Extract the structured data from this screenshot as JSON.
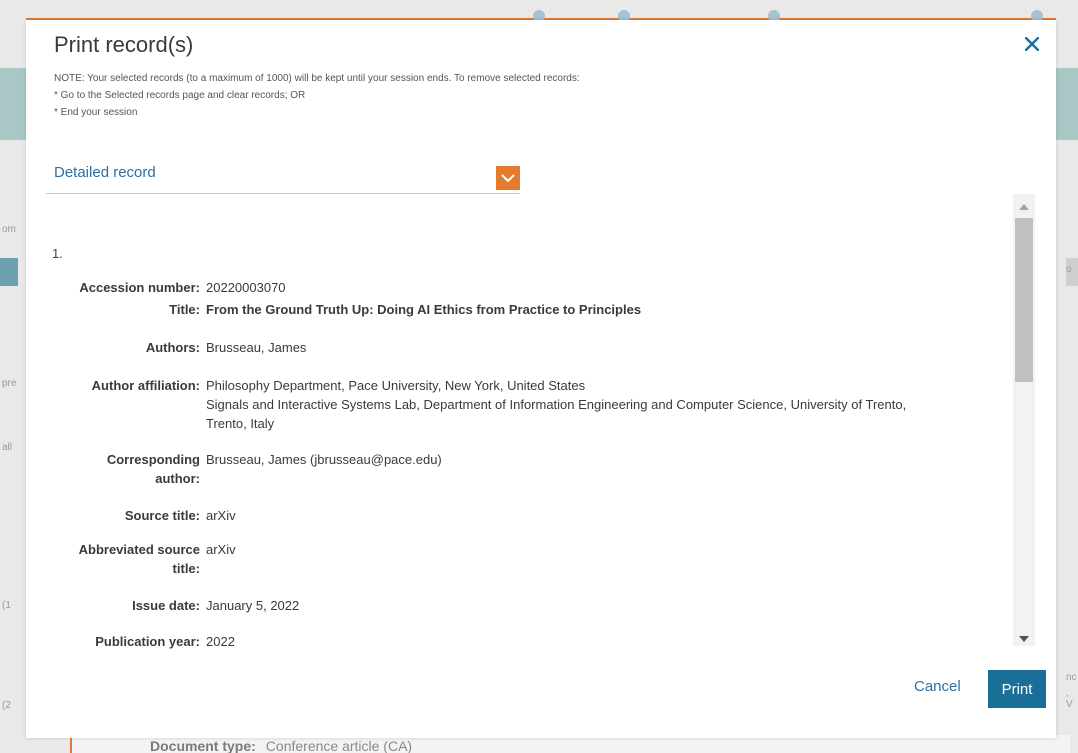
{
  "modal": {
    "title": "Print record(s)",
    "note_lines": [
      "NOTE: Your selected records (to a maximum of 1000) will be kept until your session ends. To remove selected records:",
      "* Go to the Selected records page and clear records; OR",
      "* End your session"
    ],
    "format_select": {
      "selected": "Detailed record"
    },
    "record_number": "1.",
    "fields": [
      {
        "label": "Accession number:",
        "value": "20220003070"
      },
      {
        "label": "Title:",
        "value": "From the Ground Truth Up: Doing AI Ethics from Practice to Principles"
      },
      {
        "label": "Authors:",
        "value": "Brusseau, James"
      },
      {
        "label": "Author affiliation:",
        "value_lines": [
          "Philosophy Department, Pace University, New York, United States",
          "Signals and Interactive Systems Lab, Department of Information Engineering and Computer Science, University of Trento,",
          "Trento, Italy"
        ]
      },
      {
        "label_lines": [
          "Corresponding",
          "author:"
        ],
        "value": "Brusseau, James (jbrusseau@pace.edu)"
      },
      {
        "label": "Source title:",
        "value": "arXiv"
      },
      {
        "label_lines": [
          "Abbreviated source",
          "title:"
        ],
        "value": "arXiv"
      },
      {
        "label": "Issue date:",
        "value": "January 5, 2022"
      },
      {
        "label": "Publication year:",
        "value": "2022"
      }
    ],
    "cancel_label": "Cancel",
    "print_label": "Print"
  },
  "background": {
    "doc_type_label": "Document type:",
    "doc_type_value": "Conference article (CA)",
    "side_texts": [
      "om",
      "pre",
      "all",
      "(1",
      "(2",
      "o",
      "nc",
      ", V"
    ]
  },
  "colors": {
    "accent_orange": "#e57b2c",
    "link_blue": "#2c6fa3",
    "print_button": "#1a6f99"
  },
  "icons": {
    "close": "close-icon",
    "dropdown": "chevron-down-icon",
    "scroll_up": "triangle-up-icon",
    "scroll_down": "triangle-down-icon"
  }
}
